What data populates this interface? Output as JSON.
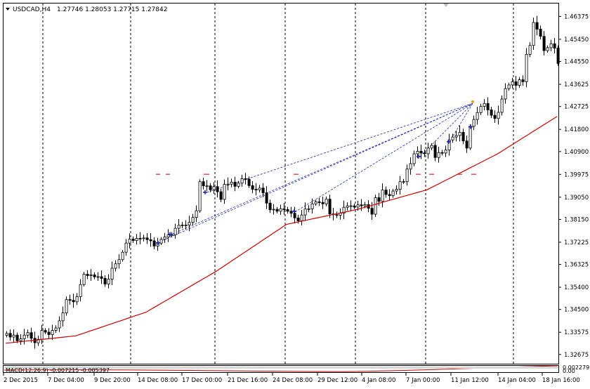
{
  "header": {
    "symbol": "USDCAD,H4",
    "ohlc": "1.27746 1.28053 1.27715 1.27842"
  },
  "indicator": {
    "label": "MACD(12,26,9) -0.007215 -0.005397",
    "right_values": [
      "0.002279",
      "0.00"
    ]
  },
  "chart_data": {
    "type": "candlestick",
    "ylim": [
      1.323,
      1.469
    ],
    "y_ticks": [
      1.46375,
      1.4545,
      1.4455,
      1.43625,
      1.42725,
      1.418,
      1.409,
      1.39975,
      1.3905,
      1.3815,
      1.37225,
      1.36325,
      1.354,
      1.345,
      1.33575,
      1.32675
    ],
    "x_ticks": [
      "2 Dec 2015",
      "7 Dec 04:00",
      "9 Dec 20:00",
      "14 Dec 08:00",
      "17 Dec 00:00",
      "21 Dec 16:00",
      "24 Dec 08:00",
      "29 Dec 12:00",
      "4 Jan 08:00",
      "7 Jan 00:00",
      "11 Jan 12:00",
      "14 Jan 04:00",
      "18 Jan 16:00"
    ],
    "period_separators": [
      "4 Dec",
      "9 Dec",
      "16 Dec",
      "21 Dec",
      "28 Dec",
      "4 Jan",
      "11 Jan",
      "18 Jan"
    ],
    "candle_count": 158,
    "closes": [
      1.3353,
      1.3338,
      1.3346,
      1.3323,
      1.3331,
      1.3346,
      1.3356,
      1.3333,
      1.3315,
      1.3329,
      1.3365,
      1.3358,
      1.3348,
      1.3365,
      1.3375,
      1.3404,
      1.3436,
      1.349,
      1.3487,
      1.3481,
      1.3502,
      1.3551,
      1.3593,
      1.3587,
      1.359,
      1.3582,
      1.3583,
      1.3576,
      1.3553,
      1.3573,
      1.3617,
      1.3635,
      1.3652,
      1.3682,
      1.3719,
      1.3735,
      1.3729,
      1.3738,
      1.3737,
      1.374,
      1.3733,
      1.3728,
      1.3707,
      1.3719,
      1.3734,
      1.3744,
      1.3752,
      1.3753,
      1.3779,
      1.3791,
      1.3792,
      1.3792,
      1.3803,
      1.3823,
      1.385,
      1.3968,
      1.3951,
      1.3951,
      1.3935,
      1.3948,
      1.3927,
      1.3896,
      1.3957,
      1.3958,
      1.3966,
      1.3949,
      1.3962,
      1.398,
      1.3978,
      1.3952,
      1.3937,
      1.3935,
      1.3942,
      1.3923,
      1.3881,
      1.3854,
      1.3856,
      1.3848,
      1.3858,
      1.3855,
      1.3848,
      1.384,
      1.3821,
      1.3809,
      1.3833,
      1.3857,
      1.3858,
      1.3878,
      1.3886,
      1.3884,
      1.3878,
      1.3897,
      1.3837,
      1.3834,
      1.3832,
      1.384,
      1.3864,
      1.387,
      1.387,
      1.3865,
      1.3874,
      1.387,
      1.3875,
      1.386,
      1.3836,
      1.3903,
      1.3888,
      1.3934,
      1.3916,
      1.3911,
      1.393,
      1.3937,
      1.3968,
      1.3968,
      1.4019,
      1.4041,
      1.4081,
      1.4091,
      1.4084,
      1.4081,
      1.4104,
      1.4115,
      1.4066,
      1.4086,
      1.4084,
      1.4096,
      1.4137,
      1.4149,
      1.4155,
      1.4168,
      1.4133,
      1.4104,
      1.4192,
      1.422,
      1.4248,
      1.4273,
      1.4285,
      1.4259,
      1.4237,
      1.4224,
      1.4249,
      1.4303,
      1.4345,
      1.436,
      1.4373,
      1.4358,
      1.4381,
      1.4373,
      1.4484,
      1.452,
      1.4613,
      1.4586,
      1.4557,
      1.4499,
      1.4511,
      1.4527,
      1.4509,
      1.4447
    ],
    "moving_average": {
      "color": "#cc0000",
      "points": [
        [
          0,
          1.3313
        ],
        [
          20,
          1.3343
        ],
        [
          40,
          1.3439
        ],
        [
          60,
          1.3605
        ],
        [
          80,
          1.3795
        ],
        [
          100,
          1.3855
        ],
        [
          120,
          1.3935
        ],
        [
          140,
          1.408
        ],
        [
          157,
          1.4232
        ]
      ]
    },
    "horizontal_markers": [
      1.3998
    ],
    "bull_color": "#000000",
    "bear_color": "#000000",
    "grid": false
  }
}
